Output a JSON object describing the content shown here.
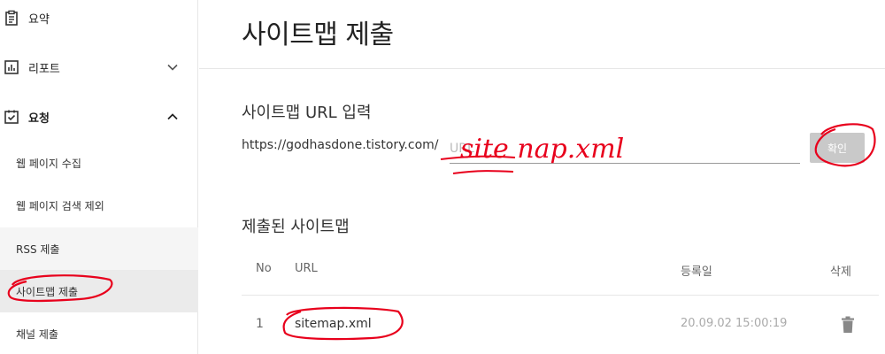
{
  "sidebar": {
    "top_items": [
      {
        "label": "요약",
        "icon": "clipboard-icon"
      },
      {
        "label": "리포트",
        "icon": "bar-chart-icon",
        "expanded": false
      },
      {
        "label": "요청",
        "icon": "checkbox-icon",
        "expanded": true
      }
    ],
    "sub_items": [
      {
        "label": "웹 페이지 수집"
      },
      {
        "label": "웹 페이지 검색 제외"
      },
      {
        "label": "RSS 제출"
      },
      {
        "label": "사이트맵 제출",
        "active": true
      },
      {
        "label": "채널 제출"
      }
    ]
  },
  "main": {
    "title": "사이트맵 제출",
    "url_section": {
      "title": "사이트맵 URL 입력",
      "prefix": "https://godhasdone.tistory.com/",
      "placeholder": "URL",
      "confirm_label": "확인"
    },
    "submitted_section": {
      "title": "제출된 사이트맵",
      "columns": {
        "no": "No",
        "url": "URL",
        "date": "등록일",
        "delete": "삭제"
      },
      "rows": [
        {
          "no": "1",
          "url": "sitemap.xml",
          "date": "20.09.02 15:00:19"
        }
      ]
    }
  },
  "annotation": {
    "handwritten_text": "site nap.xml",
    "color": "#e8001c"
  },
  "colors": {
    "button_disabled": "#c9c9c9",
    "active_nav_bg": "#ebebeb"
  }
}
